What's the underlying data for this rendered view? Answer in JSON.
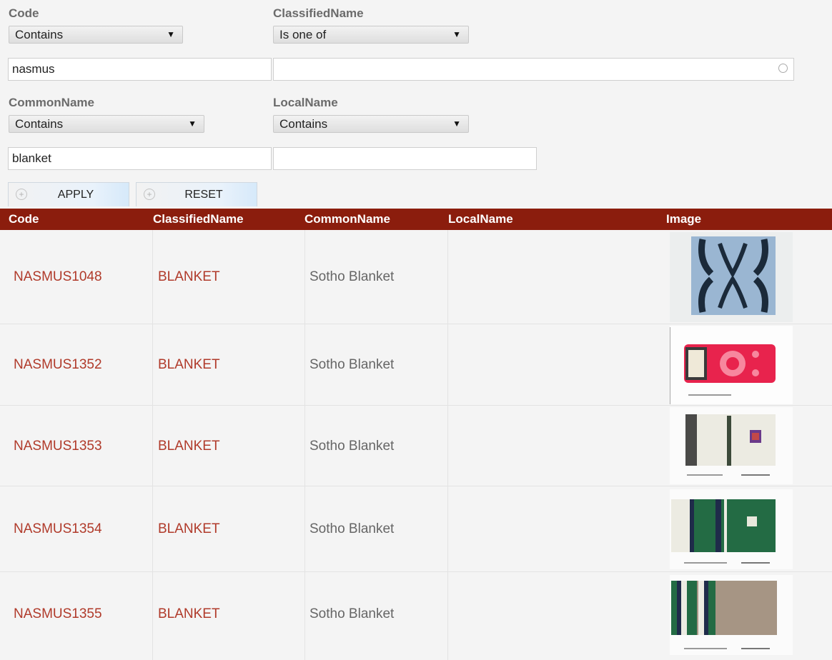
{
  "filters": {
    "code": {
      "label": "Code",
      "operator": "Contains",
      "value": "nasmus"
    },
    "classified_name": {
      "label": "ClassifiedName",
      "operator": "Is one of",
      "value": ""
    },
    "common_name": {
      "label": "CommonName",
      "operator": "Contains",
      "value": "blanket"
    },
    "local_name": {
      "label": "LocalName",
      "operator": "Contains",
      "value": ""
    }
  },
  "buttons": {
    "apply": "APPLY",
    "reset": "RESET"
  },
  "table": {
    "headers": {
      "code": "Code",
      "classified_name": "ClassifiedName",
      "common_name": "CommonName",
      "local_name": "LocalName",
      "image": "Image"
    },
    "rows": [
      {
        "code": "NASMUS1048",
        "classified_name": "BLANKET",
        "common_name": "Sotho Blanket",
        "local_name": ""
      },
      {
        "code": "NASMUS1352",
        "classified_name": "BLANKET",
        "common_name": "Sotho Blanket",
        "local_name": ""
      },
      {
        "code": "NASMUS1353",
        "classified_name": "BLANKET",
        "common_name": "Sotho Blanket",
        "local_name": ""
      },
      {
        "code": "NASMUS1354",
        "classified_name": "BLANKET",
        "common_name": "Sotho Blanket",
        "local_name": ""
      },
      {
        "code": "NASMUS1355",
        "classified_name": "BLANKET",
        "common_name": "Sotho Blanket",
        "local_name": ""
      }
    ]
  },
  "colors": {
    "header_bg": "#8b1d0d",
    "link": "#b03a2a"
  }
}
